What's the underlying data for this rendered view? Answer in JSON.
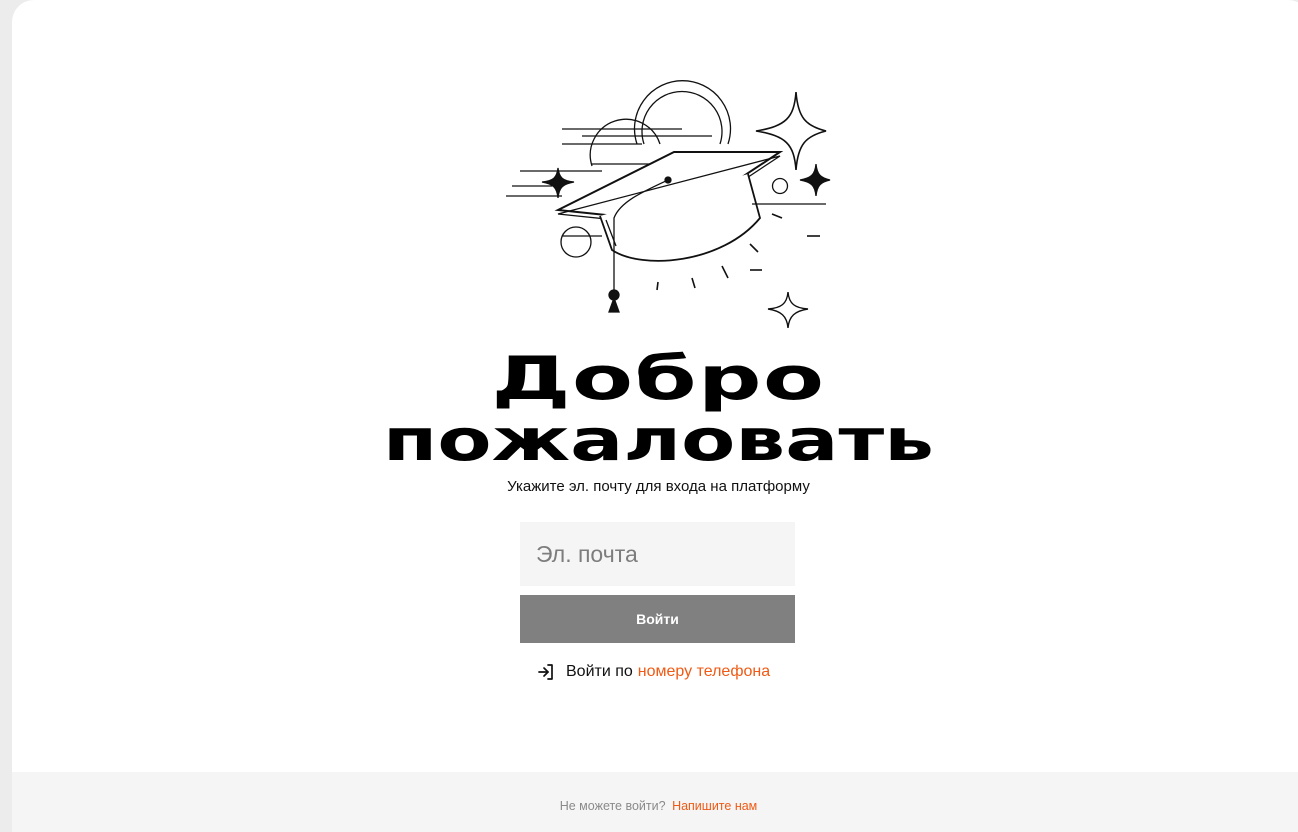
{
  "welcome": {
    "title_line1": "Добро",
    "title_line2": "пожаловать",
    "subtitle": "Укажите эл. почту для входа на платформу"
  },
  "form": {
    "email_placeholder": "Эл. почта",
    "email_value": "",
    "login_button_label": "Войти"
  },
  "phone_login": {
    "icon": "login-arrow-icon",
    "prefix": "Войти по",
    "link": "номеру телефона"
  },
  "footer": {
    "question": "Не можете войти?",
    "link": "Напишите нам"
  },
  "illustration": {
    "icon": "graduation-cap-icon"
  },
  "colors": {
    "accent": "#f05a14",
    "button_disabled": "#808080",
    "input_background": "#f5f5f5",
    "footer_background": "#f5f5f5",
    "page_background": "#ececec"
  }
}
